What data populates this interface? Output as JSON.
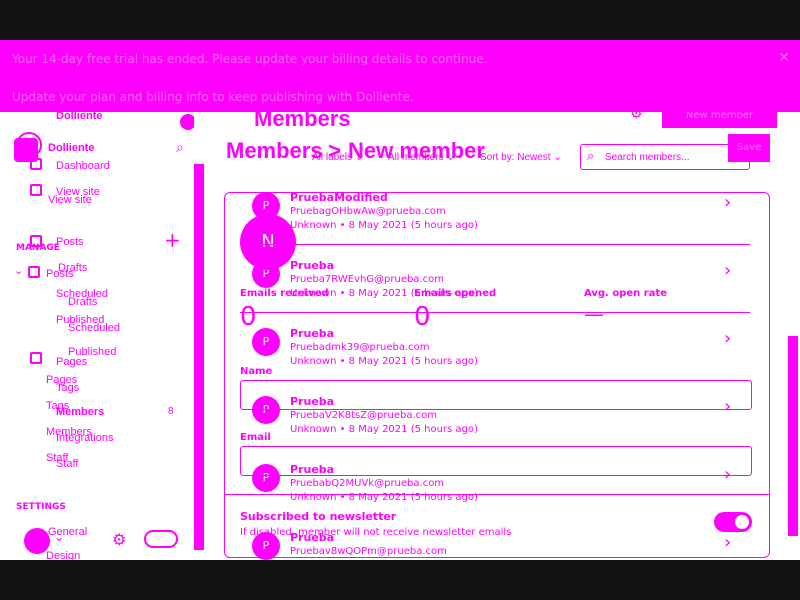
{
  "banner": {
    "line1": "Your 14-day free trial has ended. Please update your billing details to continue.",
    "line2": "Update your plan and billing info to keep publishing with Dolliente."
  },
  "sidebar": {
    "site_name": "Dolliente",
    "site_name_echo": "Dolliente",
    "items": [
      {
        "label": "Dashboard"
      },
      {
        "label": "View site"
      },
      {
        "label": "View site"
      },
      {
        "label": "Posts"
      },
      {
        "label": "Posts"
      },
      {
        "label": "Drafts"
      },
      {
        "label": "Drafts"
      },
      {
        "label": "Scheduled"
      },
      {
        "label": "Scheduled"
      },
      {
        "label": "Published"
      },
      {
        "label": "Published"
      },
      {
        "label": "Pages"
      },
      {
        "label": "Pages"
      },
      {
        "label": "Tags"
      },
      {
        "label": "Tags"
      },
      {
        "label": "Members"
      },
      {
        "label": "Members"
      },
      {
        "label": "Integrations"
      },
      {
        "label": "Staff"
      },
      {
        "label": "Staff"
      },
      {
        "label": "General"
      },
      {
        "label": "Design"
      }
    ],
    "section_manage": "MANAGE",
    "section_settings": "SETTINGS",
    "members_count": "8"
  },
  "main": {
    "title_back": "Members",
    "title_back2": "Members",
    "breadcrumb_sep": ">",
    "title_new": "New member",
    "new_member_button": "New member",
    "save_button": "Save",
    "filters": {
      "labels": "All labels",
      "members": "All members",
      "sort": "Sort by: Newest",
      "search_placeholder": "Search members..."
    },
    "avatar_big": "N",
    "stats": {
      "received_label": "Emails received",
      "received_value": "0",
      "opened_label": "Emails opened",
      "opened_value": "0",
      "rate_label": "Avg. open rate",
      "rate_value": "—"
    },
    "form": {
      "name_label": "Name",
      "email_label": "Email",
      "subscribed_label": "Subscribed to newsletter",
      "subscribed_hint": "If disabled, member will not receive newsletter emails"
    },
    "members": [
      {
        "initial": "P",
        "name": "PruebaModified",
        "email": "PruebagOHbwAw@prueba.com",
        "meta": "Unknown • 8 May 2021 (5 hours ago)"
      },
      {
        "initial": "P",
        "name": "Prueba",
        "email": "Prueba7RWEvhG@prueba.com",
        "meta": "Unknown • 8 May 2021 (5 hours ago)"
      },
      {
        "initial": "P",
        "name": "Prueba",
        "email": "Pruebadmk39@prueba.com",
        "meta": "Unknown • 8 May 2021 (5 hours ago)"
      },
      {
        "initial": "P",
        "name": "Prueba",
        "email": "PruebaV2K8tsZ@prueba.com",
        "meta": "Unknown • 8 May 2021 (5 hours ago)"
      },
      {
        "initial": "P",
        "name": "Prueba",
        "email": "PruebabQ2MUVk@prueba.com",
        "meta": "Unknown • 8 May 2021 (5 hours ago)"
      },
      {
        "initial": "P",
        "name": "Prueba",
        "email": "Pruebav8wQOPm@prueba.com",
        "meta": ""
      }
    ]
  },
  "colors": {
    "accent": "#ff00ff",
    "frame": "#111111"
  },
  "icons": [
    "close-icon",
    "search-icon",
    "plus-icon",
    "gear-icon",
    "chevron-right-icon",
    "chevron-down-icon"
  ]
}
